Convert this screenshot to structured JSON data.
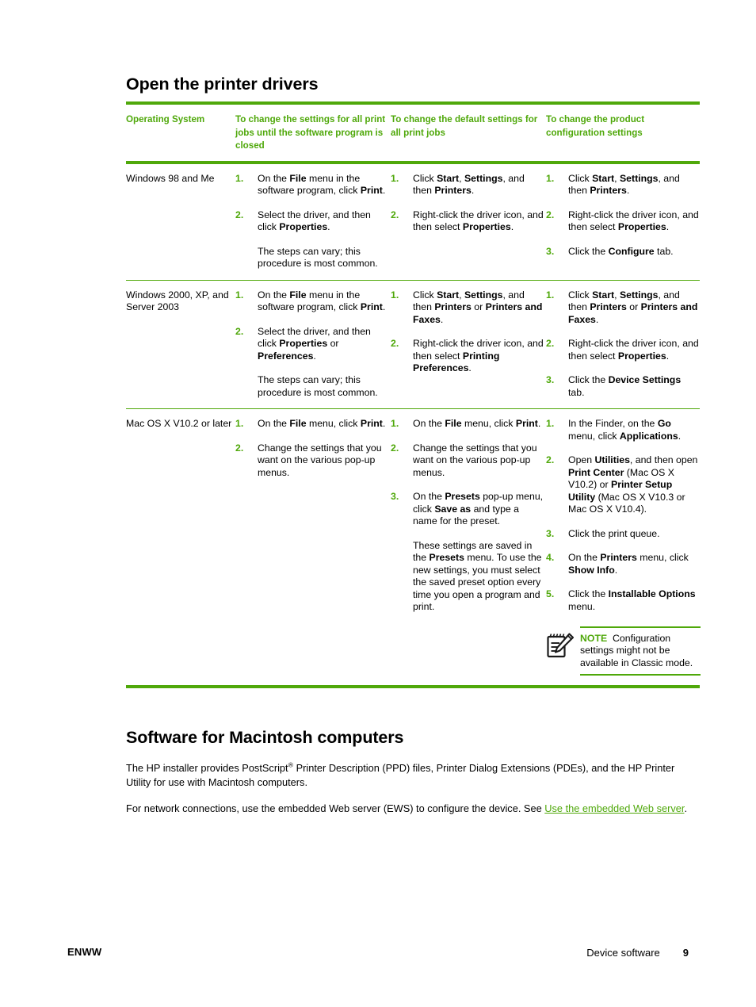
{
  "document": {
    "section_heading": "Open the printer drivers",
    "second_heading": "Software for Macintosh computers"
  },
  "table": {
    "headers": [
      "Operating System",
      "To change the settings for all print jobs until the software program is closed",
      "To change the default settings for all print jobs",
      "To change the product configuration settings"
    ],
    "rows": [
      {
        "os": "Windows 98 and Me",
        "col_a": {
          "steps": [
            {
              "num": "1.",
              "html": "On the <b>File</b> menu in the software program, click <b>Print</b>."
            },
            {
              "num": "2.",
              "html": "Select the driver, and then click <b>Properties</b>."
            }
          ],
          "tail": "The steps can vary; this procedure is most common."
        },
        "col_b": {
          "steps": [
            {
              "num": "1.",
              "html": "Click <b>Start</b>, <b>Settings</b>, and then <b>Printers</b>."
            },
            {
              "num": "2.",
              "html": "Right-click the driver icon, and then select <b>Properties</b>."
            }
          ],
          "tail": ""
        },
        "col_c": {
          "steps": [
            {
              "num": "1.",
              "html": "Click <b>Start</b>, <b>Settings</b>, and then <b>Printers</b>."
            },
            {
              "num": "2.",
              "html": "Right-click the driver icon, and then select <b>Properties</b>."
            },
            {
              "num": "3.",
              "html": "Click the <b>Configure</b> tab."
            }
          ],
          "tail": ""
        }
      },
      {
        "os": "Windows 2000, XP, and Server 2003",
        "col_a": {
          "steps": [
            {
              "num": "1.",
              "html": "On the <b>File</b> menu in the software program, click <b>Print</b>."
            },
            {
              "num": "2.",
              "html": "Select the driver, and then click <b>Properties</b> or <b>Preferences</b>."
            }
          ],
          "tail": "The steps can vary; this procedure is most common."
        },
        "col_b": {
          "steps": [
            {
              "num": "1.",
              "html": "Click <b>Start</b>, <b>Settings</b>, and then <b>Printers</b> or <b>Printers and Faxes</b>."
            },
            {
              "num": "2.",
              "html": "Right-click the driver icon, and then select <b>Printing Preferences</b>."
            }
          ],
          "tail": ""
        },
        "col_c": {
          "steps": [
            {
              "num": "1.",
              "html": "Click <b>Start</b>, <b>Settings</b>, and then <b>Printers</b> or <b>Printers and Faxes</b>."
            },
            {
              "num": "2.",
              "html": "Right-click the driver icon, and then select <b>Properties</b>."
            },
            {
              "num": "3.",
              "html": "Click the <b>Device Settings</b> tab."
            }
          ],
          "tail": ""
        }
      },
      {
        "os": "Mac OS X V10.2 or later",
        "col_a": {
          "steps": [
            {
              "num": "1.",
              "html": "On the <b>File</b> menu, click <b>Print</b>."
            },
            {
              "num": "2.",
              "html": "Change the settings that you want on the various pop-up menus."
            }
          ],
          "tail": ""
        },
        "col_b": {
          "steps": [
            {
              "num": "1.",
              "html": "On the <b>File</b> menu, click <b>Print</b>."
            },
            {
              "num": "2.",
              "html": "Change the settings that you want on the various pop-up menus."
            },
            {
              "num": "3.",
              "html": "On the <b>Presets</b> pop-up menu, click <b>Save as</b> and type a name for the preset."
            }
          ],
          "tail_html": "These settings are saved in the <b>Presets</b> menu. To use the new settings, you must select the saved preset option every time you open a program and print."
        },
        "col_c": {
          "steps": [
            {
              "num": "1.",
              "html": "In the Finder, on the <b>Go</b> menu, click <b>Applications</b>."
            },
            {
              "num": "2.",
              "html": "Open <b>Utilities</b>, and then open <b>Print Center</b> (Mac OS X V10.2) or <b>Printer Setup Utility</b> (Mac OS X V10.3 or Mac OS X V10.4)."
            },
            {
              "num": "3.",
              "html": "Click the print queue."
            },
            {
              "num": "4.",
              "html": "On the <b>Printers</b> menu, click <b>Show Info</b>."
            },
            {
              "num": "5.",
              "html": "Click the <b>Installable Options</b> menu."
            }
          ],
          "note": {
            "keyword": "NOTE",
            "text": "Configuration settings might not be available in Classic mode."
          }
        }
      }
    ]
  },
  "body": {
    "para_installer_html": "The HP installer provides PostScript<sup>®</sup> Printer Description (PPD) files, Printer Dialog Extensions (PDEs), and the HP Printer Utility for use with Macintosh computers.",
    "para_network_prefix": "For network connections, use the embedded Web server (EWS) to configure the device. See ",
    "para_network_link": "Use the embedded Web server",
    "para_network_suffix": "."
  },
  "footer": {
    "left": "ENWW",
    "right": "Device software",
    "page_number": "9"
  },
  "colors": {
    "accent_green": "#4FA80A",
    "text": "#000000"
  },
  "icons": {
    "note": "notepad-pencil-icon"
  }
}
